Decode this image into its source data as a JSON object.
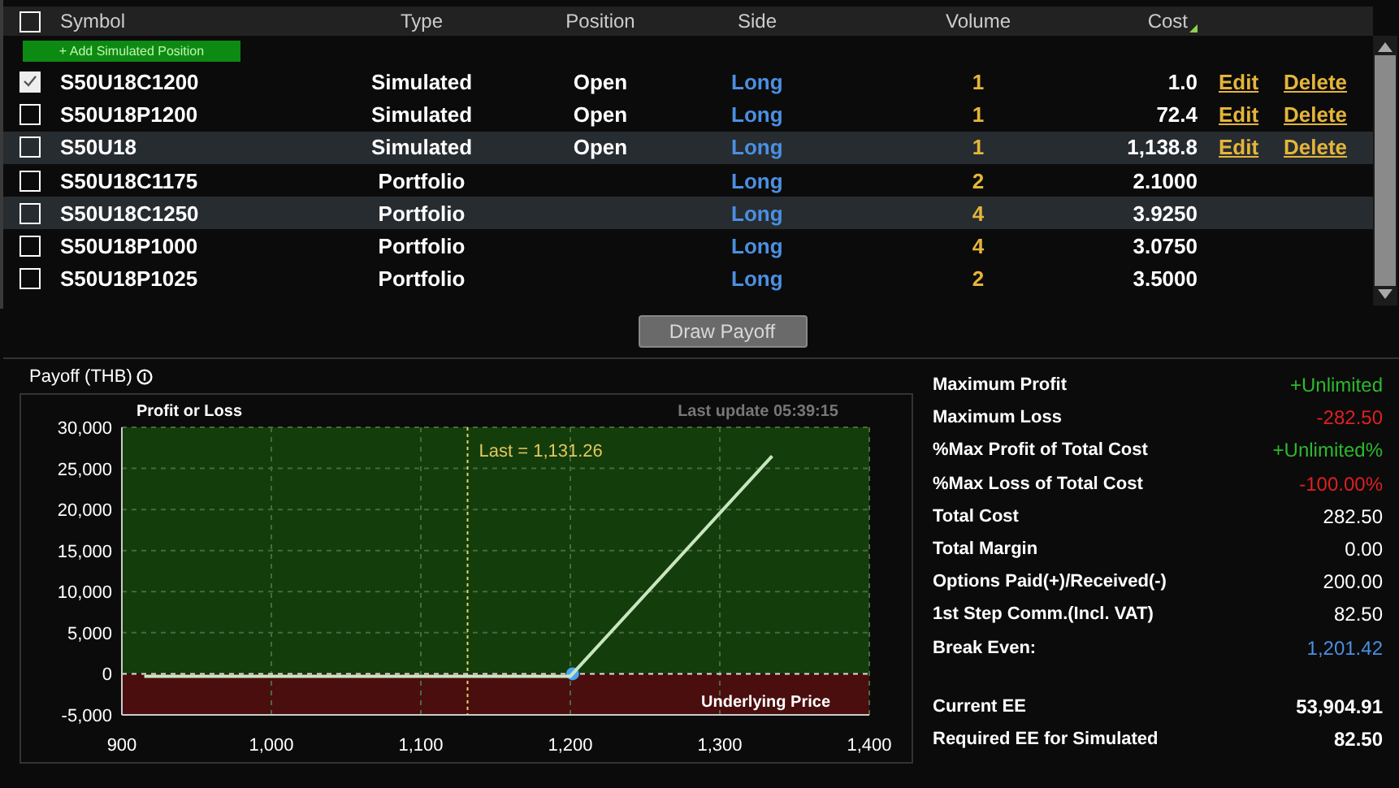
{
  "table": {
    "columns": [
      "Symbol",
      "Type",
      "Position",
      "Side",
      "Volume",
      "Cost"
    ],
    "header_checked": false,
    "add_button": "+ Add Simulated Position",
    "rows": [
      {
        "checked": true,
        "highlighted": false,
        "symbol": "S50U18C1200",
        "type": "Simulated",
        "position": "Open",
        "side": "Long",
        "volume": "1",
        "cost": "1.0",
        "actions": [
          "Edit",
          "Delete"
        ]
      },
      {
        "checked": false,
        "highlighted": false,
        "symbol": "S50U18P1200",
        "type": "Simulated",
        "position": "Open",
        "side": "Long",
        "volume": "1",
        "cost": "72.4",
        "actions": [
          "Edit",
          "Delete"
        ]
      },
      {
        "checked": false,
        "highlighted": true,
        "symbol": "S50U18",
        "type": "Simulated",
        "position": "Open",
        "side": "Long",
        "volume": "1",
        "cost": "1,138.8",
        "actions": [
          "Edit",
          "Delete"
        ]
      },
      {
        "checked": false,
        "highlighted": false,
        "symbol": "S50U18C1175",
        "type": "Portfolio",
        "side": "Long",
        "volume": "2",
        "cost": "2.1000"
      },
      {
        "checked": false,
        "highlighted": true,
        "symbol": "S50U18C1250",
        "type": "Portfolio",
        "side": "Long",
        "volume": "4",
        "cost": "3.9250"
      },
      {
        "checked": false,
        "highlighted": false,
        "symbol": "S50U18P1000",
        "type": "Portfolio",
        "side": "Long",
        "volume": "4",
        "cost": "3.0750"
      },
      {
        "checked": false,
        "highlighted": false,
        "symbol": "S50U18P1025",
        "type": "Portfolio",
        "side": "Long",
        "volume": "2",
        "cost": "3.5000"
      }
    ]
  },
  "draw_button": {
    "label": "Draw Payoff",
    "disabled": true
  },
  "payoff": {
    "title": "Payoff (THB)",
    "last_update": "Last update 05:39:15",
    "chart_data": {
      "type": "line",
      "xlabel": "Underlying Price",
      "ylabel": "Profit or Loss",
      "x": [
        915,
        1200,
        1335
      ],
      "series": [
        {
          "color": "#c8e6c0",
          "values": [
            -300,
            -300,
            26500
          ]
        }
      ],
      "grid": true,
      "bands": [
        {
          "axis": "y",
          "from": 0,
          "to": 30000,
          "color": "#143d0c"
        },
        {
          "axis": "y",
          "from": -5000,
          "to": 0,
          "color": "#4a0e0e"
        }
      ],
      "ref_lines": [
        {
          "axis": "x",
          "value": 1131.26,
          "color": "#e5d36a"
        },
        {
          "axis": "y",
          "value": 0,
          "color": "#dddddd"
        }
      ],
      "xlim": [
        900,
        1400
      ],
      "ylim": [
        -5000,
        30000
      ],
      "xticks": [
        {
          "value": 900,
          "label": "900"
        },
        {
          "value": 1000,
          "label": "1,000"
        },
        {
          "value": 1100,
          "label": "1,100"
        },
        {
          "value": 1200,
          "label": "1,200"
        },
        {
          "value": 1300,
          "label": "1,300"
        },
        {
          "value": 1400,
          "label": "1,400"
        }
      ],
      "yticks": [
        {
          "value": -5000,
          "label": "-5,000"
        },
        {
          "value": 0,
          "label": "0"
        },
        {
          "value": 5000,
          "label": "5,000"
        },
        {
          "value": 10000,
          "label": "10,000"
        },
        {
          "value": 15000,
          "label": "15,000"
        },
        {
          "value": 20000,
          "label": "20,000"
        },
        {
          "value": 25000,
          "label": "25,000"
        },
        {
          "value": 30000,
          "label": "30,000"
        }
      ],
      "annotations": [
        "Last = 1,131.26"
      ]
    }
  },
  "stats": [
    {
      "label": "Maximum Profit",
      "value": "+Unlimited",
      "color": "#2eb82e"
    },
    {
      "label": "Maximum Loss",
      "value": "-282.50",
      "color": "#e02020"
    },
    {
      "label": "%Max Profit of Total Cost",
      "value": "+Unlimited%",
      "color": "#2eb82e"
    },
    {
      "label": "%Max Loss of Total Cost",
      "value": "-100.00%",
      "color": "#e02020"
    },
    {
      "label": "Total Cost",
      "value": "282.50",
      "color": "#ffffff"
    },
    {
      "label": "Total Margin",
      "value": "0.00",
      "color": "#ffffff"
    },
    {
      "label": "Options Paid(+)/Received(-)",
      "value": "200.00",
      "color": "#ffffff"
    },
    {
      "label": "1st Step Comm.(Incl. VAT)",
      "value": "82.50",
      "color": "#ffffff"
    },
    {
      "label": "Break Even:",
      "value": "1,201.42",
      "color": "#4a90e2"
    }
  ],
  "ee_stats": [
    {
      "label": "Current EE",
      "value": "53,904.91"
    },
    {
      "label": "Required EE for Simulated",
      "value": "82.50"
    }
  ]
}
